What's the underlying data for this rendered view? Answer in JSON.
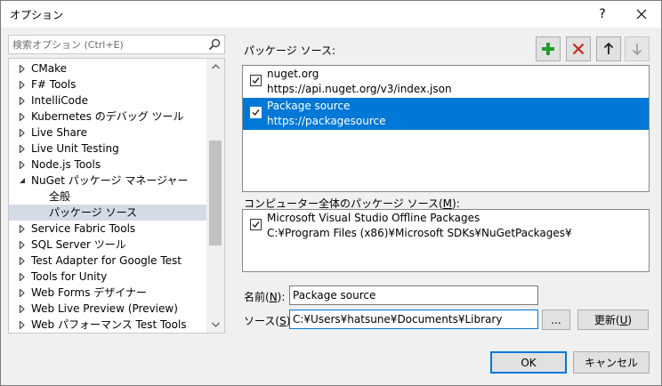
{
  "window": {
    "title": "オプション",
    "help_label": "?",
    "close_label": "✕"
  },
  "search": {
    "placeholder": "検索オプション (Ctrl+E)"
  },
  "tree": {
    "items": [
      {
        "label": "CMake",
        "expanded": false
      },
      {
        "label": "F# Tools",
        "expanded": false
      },
      {
        "label": "IntelliCode",
        "expanded": false
      },
      {
        "label": "Kubernetes のデバッグ ツール",
        "expanded": false
      },
      {
        "label": "Live Share",
        "expanded": false
      },
      {
        "label": "Live Unit Testing",
        "expanded": false
      },
      {
        "label": "Node.js Tools",
        "expanded": false
      },
      {
        "label": "NuGet パッケージ マネージャー",
        "expanded": true
      },
      {
        "label": "全般",
        "child": true
      },
      {
        "label": "パッケージ ソース",
        "child": true,
        "selected": true
      },
      {
        "label": "Service Fabric Tools",
        "expanded": false
      },
      {
        "label": "SQL Server ツール",
        "expanded": false
      },
      {
        "label": "Test Adapter for Google Test",
        "expanded": false
      },
      {
        "label": "Tools for Unity",
        "expanded": false
      },
      {
        "label": "Web Forms デザイナー",
        "expanded": false
      },
      {
        "label": "Web Live Preview (Preview)",
        "expanded": false
      },
      {
        "label": "Web パフォーマンス Test Tools",
        "expanded": false
      }
    ]
  },
  "sources": {
    "label": "パッケージ ソース:",
    "toolbar": {
      "add_icon": "plus-icon",
      "remove_icon": "x-icon",
      "up_icon": "arrow-up-icon",
      "down_icon": "arrow-down-icon"
    },
    "items": [
      {
        "name": "nuget.org",
        "url": "https://api.nuget.org/v3/index.json",
        "checked": true
      },
      {
        "name": "Package source",
        "url": "https://packagesource",
        "checked": true,
        "selected": true
      }
    ]
  },
  "machine_sources": {
    "label_prefix": "コンピューター全体のパッケージ ソース(",
    "label_key": "M",
    "label_suffix": "):",
    "items": [
      {
        "name": "Microsoft Visual Studio Offline Packages",
        "url": "C:¥Program Files (x86)¥Microsoft SDKs¥NuGetPackages¥",
        "checked": true
      }
    ]
  },
  "form": {
    "name_label_prefix": "名前(",
    "name_label_key": "N",
    "name_label_suffix": "):",
    "name_value": "Package source",
    "source_label_prefix": "ソース(",
    "source_label_key": "S",
    "source_label_suffix": "):",
    "source_value": "C:¥Users¥hatsune¥Documents¥Library",
    "browse_label": "...",
    "update_label_prefix": "更新(",
    "update_label_key": "U",
    "update_label_suffix": ")"
  },
  "footer": {
    "ok_label": "OK",
    "cancel_label": "キャンセル"
  },
  "colors": {
    "selection": "#0078d7",
    "add_green": "#1e9e2e",
    "remove_red": "#c42b1c",
    "tree_selected": "#d4dbe6"
  }
}
